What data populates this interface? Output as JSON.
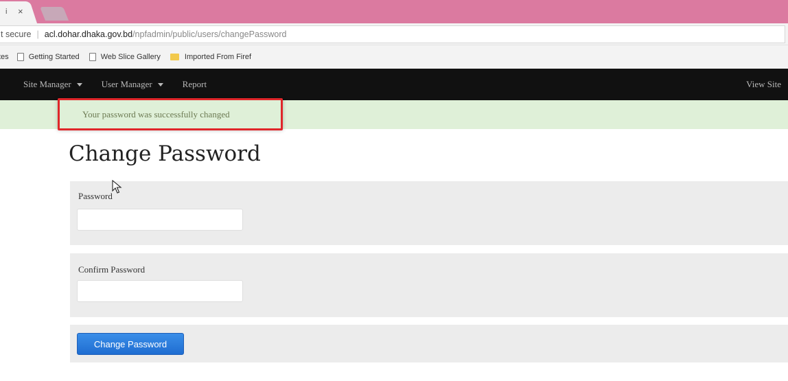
{
  "browser": {
    "tab": {
      "label": "i",
      "close": "×"
    },
    "address": {
      "security_text": "t secure",
      "host": "acl.dohar.dhaka.gov.bd",
      "path": "/npfadmin/public/users/changePassword"
    },
    "bookmarks": [
      {
        "label": "tes"
      },
      {
        "label": "Getting Started",
        "icon": "page-icon"
      },
      {
        "label": "Web Slice Gallery",
        "icon": "page-icon"
      },
      {
        "label": "Imported From Firef",
        "icon": "folder-icon"
      }
    ]
  },
  "site_nav": {
    "items": [
      {
        "label": "Site Manager",
        "dropdown": true
      },
      {
        "label": "User Manager",
        "dropdown": true
      },
      {
        "label": "Report",
        "dropdown": false
      }
    ],
    "right_link": "View Site"
  },
  "alert": {
    "message": "Your password was successfully changed",
    "highlight_color": "#e0262a",
    "background": "#dff0d8"
  },
  "form": {
    "title": "Change Password",
    "password": {
      "label": "Password",
      "value": ""
    },
    "confirm_password": {
      "label": "Confirm Password",
      "value": ""
    },
    "submit_label": "Change Password",
    "accent": "#1f6dd1"
  }
}
